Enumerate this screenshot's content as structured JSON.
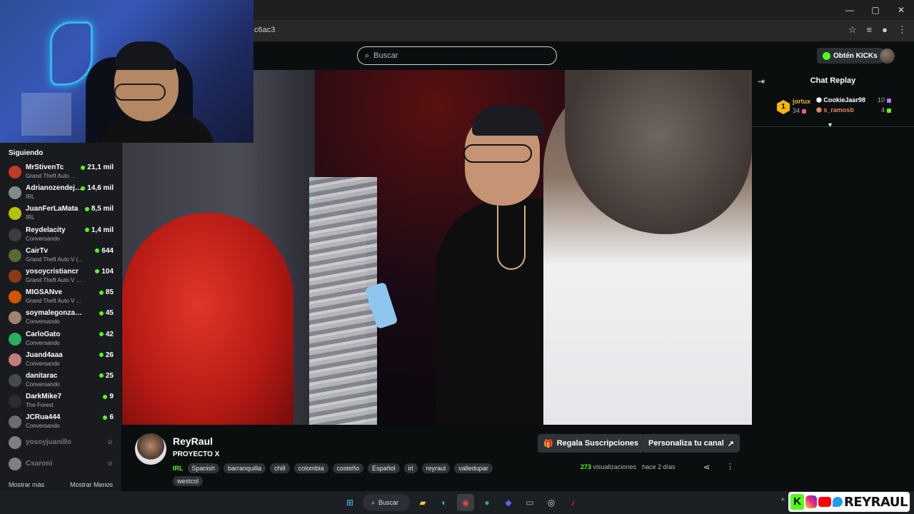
{
  "browser": {
    "url_fragment": "c6ac3",
    "window_controls": [
      "—",
      "▢",
      "✕"
    ]
  },
  "header": {
    "search_placeholder": "Buscar",
    "kicks_label": "Obtén KICKs"
  },
  "sidebar": {
    "title": "Siguiendo",
    "items": [
      {
        "name": "MrStivenTc",
        "category": "Grand Theft Auto ...",
        "viewers": "21,1 mil",
        "color": "#c0392b"
      },
      {
        "name": "Adrianozendejas",
        "category": "IRL",
        "viewers": "14,6 mil",
        "color": "#7f8c8d"
      },
      {
        "name": "JuanFerLaMata",
        "category": "IRL",
        "viewers": "8,5 mil",
        "color": "#b5c20c"
      },
      {
        "name": "Reydelacity",
        "category": "Conversando",
        "viewers": "1,4 mil",
        "color": "#3d3d3d"
      },
      {
        "name": "CairTv",
        "category": "Grand Theft Auto V (...",
        "viewers": "644",
        "color": "#556b2f"
      },
      {
        "name": "yosoycristiancr",
        "category": "Grand Theft Auto V (G...",
        "viewers": "104",
        "color": "#8e3a1a"
      },
      {
        "name": "MIGSANve",
        "category": "Grand Theft Auto V (GTA)",
        "viewers": "85",
        "color": "#d35400"
      },
      {
        "name": "soymalegonzalez",
        "category": "Conversando",
        "viewers": "45",
        "color": "#a0826d"
      },
      {
        "name": "CarloGato",
        "category": "Conversando",
        "viewers": "42",
        "color": "#27ae60"
      },
      {
        "name": "Juand4aaa",
        "category": "Conversando",
        "viewers": "26",
        "color": "#c27c7c"
      },
      {
        "name": "danitarac",
        "category": "Conversando",
        "viewers": "25",
        "color": "#444a52"
      },
      {
        "name": "DarkMike7",
        "category": "The Forest",
        "viewers": "9",
        "color": "#2c2c2c"
      },
      {
        "name": "JCRua444",
        "category": "Conversando",
        "viewers": "6",
        "color": "#6d6d6d"
      }
    ],
    "offline": [
      {
        "name": "yosoyjuanillo"
      },
      {
        "name": "Csaroni"
      }
    ],
    "show_more": "Mostrar más",
    "show_less": "Mostrar Menos"
  },
  "chat": {
    "title": "Chat Replay",
    "top_gifter": {
      "rank": "1",
      "user": "jortux",
      "count": "34"
    },
    "gifters": [
      {
        "user": "CookieJaar98",
        "count": "10",
        "color": "#ffffff",
        "gift_color": "#b37bff"
      },
      {
        "user": "s_ramosb",
        "count": "4",
        "color": "#e88a55",
        "gift_color": "#53fc18"
      }
    ]
  },
  "channel": {
    "name": "ReyRaul",
    "title": "PROYECTO X",
    "category": "IRL",
    "tags": [
      "Spanish",
      "barranquilla",
      "chill",
      "colombia",
      "costeño",
      "Español",
      "irl",
      "reyraul",
      "valledupar",
      "westcol"
    ],
    "subscribe_button": "Regala Suscripciones",
    "customize_button": "Personaliza tu canal",
    "views_count": "273",
    "views_label": "visualizaciones",
    "time_ago": "hace 2 días"
  },
  "taskbar": {
    "search_label": "Buscar",
    "overlay_name": "REYRAUL"
  },
  "colors": {
    "kick_green": "#53fc18",
    "background": "#0b0e0f",
    "sidebar": "#191b1f",
    "button": "#2f3337",
    "gifter_gold": "#f5b70a"
  }
}
